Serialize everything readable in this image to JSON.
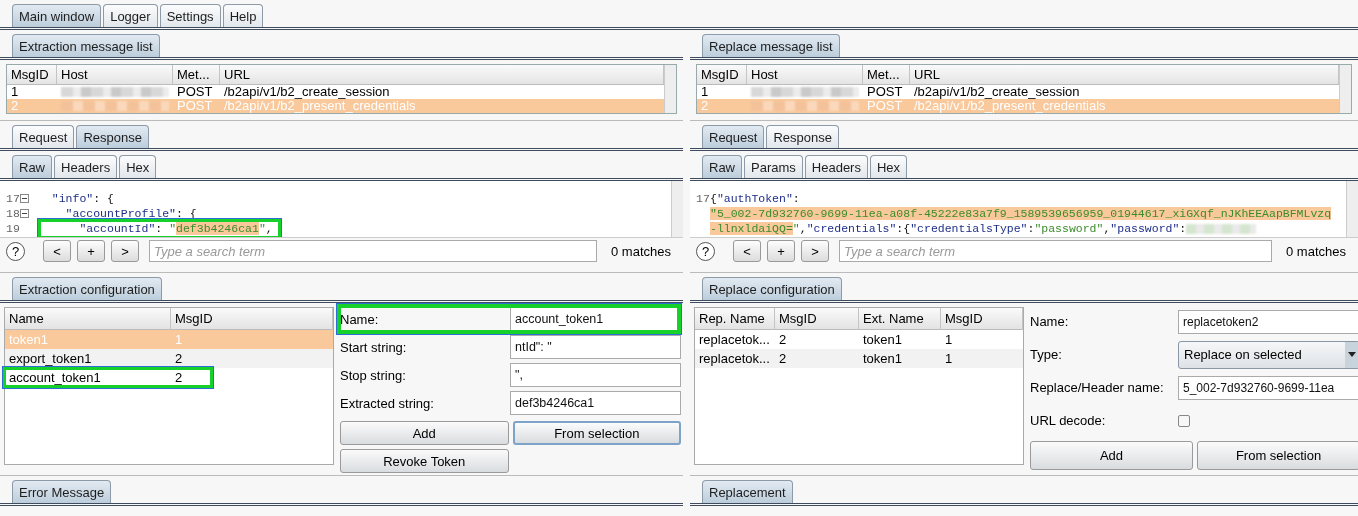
{
  "main_tabs": [
    {
      "label": "Main window",
      "selected": true
    },
    {
      "label": "Logger",
      "selected": false
    },
    {
      "label": "Settings",
      "selected": false
    },
    {
      "label": "Help",
      "selected": false
    }
  ],
  "panes": [
    {
      "list_tab": "Extraction message list",
      "messages": {
        "columns": [
          "MsgID",
          "Host",
          "Met...",
          "URL"
        ],
        "rows": [
          {
            "msgid": "1",
            "host_redacted": true,
            "method": "POST",
            "url": "/b2api/v1/b2_create_session",
            "selected": false
          },
          {
            "msgid": "2",
            "host_redacted": true,
            "method": "POST",
            "url": "/b2api/v1/b2_present_credentials",
            "selected": true
          }
        ]
      },
      "viewer_tabs": [
        {
          "label": "Request",
          "selected": false
        },
        {
          "label": "Response",
          "selected": true
        }
      ],
      "format_tabs": [
        {
          "label": "Raw",
          "selected": true
        },
        {
          "label": "Headers",
          "selected": false
        },
        {
          "label": "Hex",
          "selected": false
        }
      ],
      "code": [
        {
          "number": "17",
          "foldable": true,
          "highlighted": false,
          "redacted_tail": false,
          "tokens": [
            {
              "text": "  \"info\"",
              "kind": "key",
              "selected": false
            },
            {
              "text": ": {",
              "kind": "punct",
              "selected": false
            }
          ]
        },
        {
          "number": "18",
          "foldable": true,
          "highlighted": false,
          "redacted_tail": false,
          "tokens": [
            {
              "text": "    \"accountProfile\"",
              "kind": "key",
              "selected": false
            },
            {
              "text": ": {",
              "kind": "punct",
              "selected": false
            }
          ]
        },
        {
          "number": "19",
          "foldable": false,
          "highlighted": true,
          "redacted_tail": false,
          "tokens": [
            {
              "text": "      \"accountId\"",
              "kind": "key",
              "selected": false
            },
            {
              "text": ": ",
              "kind": "punct",
              "selected": false
            },
            {
              "text": "\"",
              "kind": "string",
              "selected": false
            },
            {
              "text": "def3b4246ca1",
              "kind": "string",
              "selected": true
            },
            {
              "text": "\"",
              "kind": "string",
              "selected": false
            },
            {
              "text": ",",
              "kind": "punct",
              "selected": false
            }
          ]
        }
      ],
      "search": {
        "help": "?",
        "buttons": [
          "<",
          "+",
          ">"
        ],
        "placeholder": "Type a search term",
        "matches": "0 matches"
      },
      "config_tab": "Extraction configuration",
      "config_table": {
        "columns": [
          "Name",
          "MsgID"
        ],
        "rows": [
          {
            "cells": [
              "token1",
              "1"
            ],
            "selected": true,
            "highlighted": false
          },
          {
            "cells": [
              "export_token1",
              "2"
            ],
            "selected": false,
            "highlighted": false
          },
          {
            "cells": [
              "account_token1",
              "2"
            ],
            "selected": false,
            "highlighted": true
          }
        ]
      },
      "form": {
        "fields": [
          {
            "kind": "text",
            "label": "Name:",
            "value": "account_token1",
            "highlighted": true
          },
          {
            "kind": "text",
            "label": "Start string:",
            "value": "ntId\": \"",
            "highlighted": false
          },
          {
            "kind": "text",
            "label": "Stop string:",
            "value": "\",",
            "highlighted": false
          },
          {
            "kind": "text",
            "label": "Extracted string:",
            "value": "def3b4246ca1",
            "highlighted": false
          }
        ],
        "buttons": [
          {
            "label": "Add",
            "focused": false
          },
          {
            "label": "From selection",
            "focused": true
          },
          {
            "label": "Revoke Token",
            "focused": false
          }
        ]
      },
      "bottom_tab": "Error Message"
    },
    {
      "list_tab": "Replace message list",
      "messages": {
        "columns": [
          "MsgID",
          "Host",
          "Met...",
          "URL"
        ],
        "rows": [
          {
            "msgid": "1",
            "host_redacted": true,
            "method": "POST",
            "url": "/b2api/v1/b2_create_session",
            "selected": false
          },
          {
            "msgid": "2",
            "host_redacted": true,
            "method": "POST",
            "url": "/b2api/v1/b2_present_credentials",
            "selected": true
          }
        ]
      },
      "viewer_tabs": [
        {
          "label": "Request",
          "selected": true
        },
        {
          "label": "Response",
          "selected": false
        }
      ],
      "format_tabs": [
        {
          "label": "Raw",
          "selected": true
        },
        {
          "label": "Params",
          "selected": false
        },
        {
          "label": "Headers",
          "selected": false
        },
        {
          "label": "Hex",
          "selected": false
        }
      ],
      "code": [
        {
          "number": "17",
          "foldable": false,
          "highlighted": false,
          "redacted_tail": false,
          "tokens": [
            {
              "text": "{",
              "kind": "punct",
              "selected": false
            },
            {
              "text": "\"authToken\"",
              "kind": "key",
              "selected": false
            },
            {
              "text": ":",
              "kind": "punct",
              "selected": false
            }
          ]
        },
        {
          "foldable": false,
          "highlighted": false,
          "redacted_tail": false,
          "tokens": [
            {
              "text": "\"5_002-7d932760-9699-11ea-a08f-45222e83a7f9_1589539656959_01944617_xiGXqf_nJKhEEAapBFMLvzq",
              "kind": "string",
              "selected": true
            }
          ]
        },
        {
          "foldable": false,
          "highlighted": false,
          "redacted_tail": true,
          "tokens": [
            {
              "text": "-llnxldaiQQ=",
              "kind": "string",
              "selected": true
            },
            {
              "text": "\"",
              "kind": "string",
              "selected": false
            },
            {
              "text": ",",
              "kind": "punct",
              "selected": false
            },
            {
              "text": "\"credentials\"",
              "kind": "key",
              "selected": false
            },
            {
              "text": ":{",
              "kind": "punct",
              "selected": false
            },
            {
              "text": "\"credentialsType\"",
              "kind": "key",
              "selected": false
            },
            {
              "text": ":",
              "kind": "punct",
              "selected": false
            },
            {
              "text": "\"password\"",
              "kind": "string",
              "selected": false
            },
            {
              "text": ",",
              "kind": "punct",
              "selected": false
            },
            {
              "text": "\"password\"",
              "kind": "key",
              "selected": false
            },
            {
              "text": ":",
              "kind": "punct",
              "selected": false
            }
          ]
        }
      ],
      "search": {
        "help": "?",
        "buttons": [
          "<",
          "+",
          ">"
        ],
        "placeholder": "Type a search term",
        "matches": "0 matches"
      },
      "config_tab": "Replace configuration",
      "config_table": {
        "columns": [
          "Rep. Name",
          "MsgID",
          "Ext. Name",
          "MsgID"
        ],
        "rows": [
          {
            "cells": [
              "replacetok...",
              "2",
              "token1",
              "1"
            ],
            "selected": false,
            "highlighted": false
          },
          {
            "cells": [
              "replacetok...",
              "2",
              "token1",
              "1"
            ],
            "selected": false,
            "highlighted": false
          }
        ]
      },
      "form": {
        "fields": [
          {
            "kind": "text",
            "label": "Name:",
            "value": "replacetoken2",
            "highlighted": false
          },
          {
            "kind": "select",
            "label": "Type:",
            "value": "Replace on selected",
            "highlighted": false
          },
          {
            "kind": "text",
            "label": "Replace/Header name:",
            "value": "5_002-7d932760-9699-11ea",
            "highlighted": false
          },
          {
            "kind": "checkbox",
            "label": "URL decode:",
            "checked": false,
            "highlighted": false
          }
        ],
        "buttons": [
          {
            "label": "Add",
            "focused": false
          },
          {
            "label": "From selection",
            "focused": false
          }
        ]
      },
      "bottom_tab": "Replacement"
    }
  ]
}
